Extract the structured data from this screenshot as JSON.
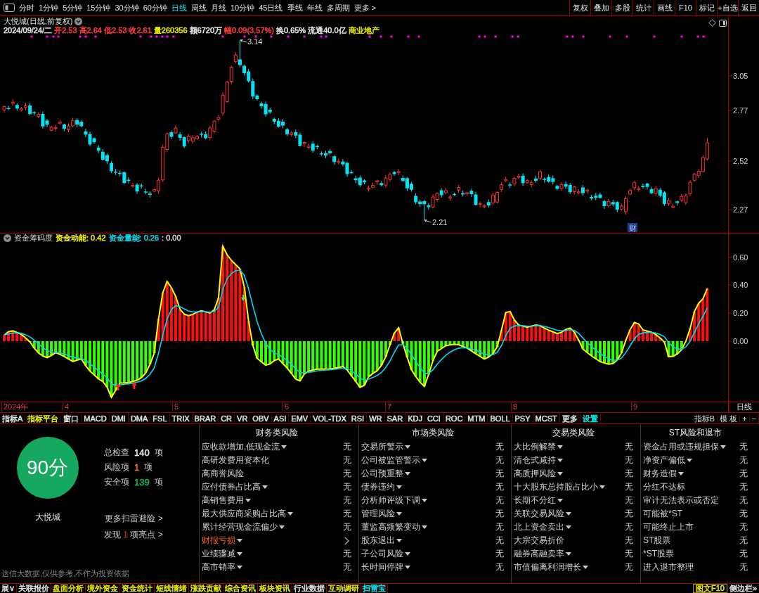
{
  "toolbar": {
    "tabs": [
      {
        "label": "分时",
        "selected": false
      },
      {
        "label": "1分钟",
        "selected": false
      },
      {
        "label": "5分钟",
        "selected": false
      },
      {
        "label": "15分钟",
        "selected": false
      },
      {
        "label": "30分钟",
        "selected": false
      },
      {
        "label": "60分钟",
        "selected": false
      },
      {
        "label": "日线",
        "selected": true
      },
      {
        "label": "周线",
        "selected": false
      },
      {
        "label": "月线",
        "selected": false
      },
      {
        "label": "10分钟",
        "selected": false
      },
      {
        "label": "45日线",
        "selected": false
      },
      {
        "label": "季线",
        "selected": false
      },
      {
        "label": "年线",
        "selected": false
      },
      {
        "label": "多周期",
        "selected": false
      },
      {
        "label": "更多 >",
        "selected": false
      }
    ],
    "buttons": [
      "复权",
      "叠加",
      "多股",
      "统计",
      "画线",
      "F10",
      "标记",
      "+自选",
      "返回"
    ]
  },
  "quote": {
    "title": "大悦城(日线,前复权)",
    "fields": [
      {
        "text": "2024/09/24/二",
        "color": "#e6e6e6"
      },
      {
        "text": "开2.53",
        "color": "#ff3c3c"
      },
      {
        "text": "高2.64",
        "color": "#ff3c3c"
      },
      {
        "text": "低2.53",
        "color": "#ff3c3c"
      },
      {
        "text": "收2.61",
        "color": "#ff3c3c"
      },
      {
        "text": "量260356",
        "color": "#e6e600"
      },
      {
        "text": "额6720万",
        "color": "#e6e6e6"
      },
      {
        "text": "幅0.09(3.57%)",
        "color": "#ff3c3c"
      },
      {
        "text": "换0.65%",
        "color": "#e6e6e6"
      },
      {
        "text": "流通40.0亿",
        "color": "#e6e6e6"
      },
      {
        "text": "商业地产",
        "color": "#e6e600"
      }
    ]
  },
  "price_chart": {
    "axis_labels": [
      "3.05",
      "2.77",
      "2.52",
      "2.27"
    ],
    "high_label": "3.14",
    "low_label": "2.21",
    "badge": "财"
  },
  "indicator": {
    "name": "资金筹码度",
    "readings": [
      {
        "text": "资金动能: 0.42",
        "color": "#f0f000"
      },
      {
        "text": "资金量能: 0.26",
        "color": "#00d8e8"
      },
      {
        "text": ": 0.00",
        "color": "#d0d0d0"
      }
    ],
    "axis_labels": [
      "0.60",
      "0.40",
      "0.20",
      "0.00"
    ]
  },
  "date_axis": {
    "labels": [
      "2024年",
      "4",
      "5",
      "6",
      "7",
      "8",
      "9"
    ],
    "period": "日线"
  },
  "indicator_tabs": {
    "items": [
      {
        "label": "指标A",
        "color": "#e0e0e0"
      },
      {
        "label": "指标平台",
        "color": "#f0f000"
      },
      {
        "label": "窗口",
        "color": "#e0e0e0"
      },
      {
        "label": "MACD",
        "color": "#e0e0e0"
      },
      {
        "label": "DMI",
        "color": "#e0e0e0"
      },
      {
        "label": "DMA",
        "color": "#e0e0e0"
      },
      {
        "label": "FSL",
        "color": "#e0e0e0"
      },
      {
        "label": "TRIX",
        "color": "#e0e0e0"
      },
      {
        "label": "BRAR",
        "color": "#e0e0e0"
      },
      {
        "label": "CR",
        "color": "#e0e0e0"
      },
      {
        "label": "VR",
        "color": "#e0e0e0"
      },
      {
        "label": "OBV",
        "color": "#e0e0e0"
      },
      {
        "label": "ASI",
        "color": "#e0e0e0"
      },
      {
        "label": "EMV",
        "color": "#e0e0e0"
      },
      {
        "label": "VOL-TDX",
        "color": "#e0e0e0"
      },
      {
        "label": "RSI",
        "color": "#e0e0e0"
      },
      {
        "label": "WR",
        "color": "#e0e0e0"
      },
      {
        "label": "SAR",
        "color": "#e0e0e0"
      },
      {
        "label": "KDJ",
        "color": "#e0e0e0"
      },
      {
        "label": "CCI",
        "color": "#e0e0e0"
      },
      {
        "label": "ROC",
        "color": "#e0e0e0"
      },
      {
        "label": "MTM",
        "color": "#e0e0e0"
      },
      {
        "label": "BOLL",
        "color": "#e0e0e0"
      },
      {
        "label": "PSY",
        "color": "#e0e0e0"
      },
      {
        "label": "MCST",
        "color": "#e0e0e0"
      },
      {
        "label": "更多",
        "color": "#e0e0e0"
      },
      {
        "label": "设置",
        "color": "#00e8e8"
      }
    ],
    "right": [
      "指标B",
      "模 板",
      "+",
      "−"
    ]
  },
  "risk_scan": {
    "score": "90分",
    "stock": "大悦城",
    "stats": [
      {
        "label": "总检查",
        "count": "140",
        "unit": "项",
        "color": "#e6e6e6"
      },
      {
        "label": "风险项",
        "count": "1",
        "unit": "项",
        "color": "#ff6a1a"
      },
      {
        "label": "安全项",
        "count": "139",
        "unit": "项",
        "color": "#19b35a"
      }
    ],
    "more_link": "更多扫雷避险 >",
    "highlight": {
      "prefix": "发现",
      "count": "1",
      "suffix": "项亮点 >"
    },
    "disclaimer": "达信大数据,仅供参考,不作为投资依据",
    "categories": [
      {
        "title": "财务类风险",
        "rows": [
          {
            "label": "应收款增加,低现金流",
            "menu": true,
            "flagged": false,
            "result": "无"
          },
          {
            "label": "高研发费用资本化",
            "menu": false,
            "flagged": false,
            "result": "无"
          },
          {
            "label": "高商誉风险",
            "menu": false,
            "flagged": false,
            "result": "无"
          },
          {
            "label": "应付债券占比高",
            "menu": true,
            "flagged": false,
            "result": "无"
          },
          {
            "label": "高销售费用",
            "menu": true,
            "flagged": false,
            "result": "无"
          },
          {
            "label": "最大供应商采购占比高",
            "menu": true,
            "flagged": false,
            "result": "无"
          },
          {
            "label": "累计经营现金流偏少",
            "menu": true,
            "flagged": false,
            "result": "无"
          },
          {
            "label": "财报亏损",
            "menu": true,
            "flagged": true
          },
          {
            "label": "业绩骤减",
            "menu": true,
            "flagged": false,
            "result": "无"
          },
          {
            "label": "高市销率",
            "menu": true,
            "flagged": false,
            "result": "无"
          }
        ]
      },
      {
        "title": "市场类风险",
        "rows": [
          {
            "label": "交易所警示",
            "menu": true,
            "flagged": false,
            "result": "无"
          },
          {
            "label": "公司被监管警示",
            "menu": true,
            "flagged": false,
            "result": "无"
          },
          {
            "label": "公司预重整",
            "menu": true,
            "flagged": false,
            "result": "无"
          },
          {
            "label": "债券违约",
            "menu": true,
            "flagged": false,
            "result": "无"
          },
          {
            "label": "分析师评级下调",
            "menu": true,
            "flagged": false,
            "result": "无"
          },
          {
            "label": "管理风险",
            "menu": true,
            "flagged": false,
            "result": "无"
          },
          {
            "label": "董监高频繁变动",
            "menu": true,
            "flagged": false,
            "result": "无"
          },
          {
            "label": "股东退出",
            "menu": true,
            "flagged": false,
            "result": "无"
          },
          {
            "label": "子公司风险",
            "menu": true,
            "flagged": false,
            "result": "无"
          },
          {
            "label": "长时间停牌",
            "menu": true,
            "flagged": false,
            "result": "无"
          }
        ]
      },
      {
        "title": "交易类风险",
        "rows": [
          {
            "label": "大比例解禁",
            "menu": true,
            "flagged": false,
            "result": "无"
          },
          {
            "label": "清仓式减持",
            "menu": true,
            "flagged": false,
            "result": "无"
          },
          {
            "label": "高质押风险",
            "menu": true,
            "flagged": false,
            "result": "无"
          },
          {
            "label": "十大股东总持股占比小",
            "menu": true,
            "flagged": false,
            "result": "无"
          },
          {
            "label": "长期不分红",
            "menu": true,
            "flagged": false,
            "result": "无"
          },
          {
            "label": "关联交易风险",
            "menu": true,
            "flagged": false,
            "result": "无"
          },
          {
            "label": "北上资金卖出",
            "menu": true,
            "flagged": false,
            "result": "无"
          },
          {
            "label": "大宗交易折价",
            "menu": false,
            "flagged": false,
            "result": "无"
          },
          {
            "label": "融券高融卖率",
            "menu": true,
            "flagged": false,
            "result": "无"
          },
          {
            "label": "市值偏离利润增长",
            "menu": true,
            "flagged": false,
            "result": "无"
          }
        ]
      },
      {
        "title": "ST风险和退市",
        "rows": [
          {
            "label": "资金占用或违规担保",
            "menu": true,
            "flagged": false,
            "result": "无"
          },
          {
            "label": "净资产偏低",
            "menu": true,
            "flagged": false,
            "result": "无"
          },
          {
            "label": "财务造假",
            "menu": true,
            "flagged": false,
            "result": "无"
          },
          {
            "label": "分红不达标",
            "menu": false,
            "flagged": false,
            "result": "无"
          },
          {
            "label": "审计无法表示或否定",
            "menu": false,
            "flagged": false,
            "result": "无"
          },
          {
            "label": "可能被*ST",
            "menu": false,
            "flagged": false,
            "result": "无"
          },
          {
            "label": "可能终止上市",
            "menu": false,
            "flagged": false,
            "result": "无"
          },
          {
            "label": "ST股票",
            "menu": false,
            "flagged": false,
            "result": "无"
          },
          {
            "label": "*ST股票",
            "menu": false,
            "flagged": false,
            "result": "无"
          },
          {
            "label": "进入退市整理",
            "menu": false,
            "flagged": false,
            "result": "无"
          }
        ]
      }
    ]
  },
  "bottom_tabs": {
    "items": [
      {
        "label": "展∨",
        "color": "#e0e0e0",
        "selected": false
      },
      {
        "label": "关联报价",
        "color": "#e0e0e0",
        "selected": false
      },
      {
        "label": "盘面分析",
        "color": "#e8e800",
        "selected": false
      },
      {
        "label": "境外资金",
        "color": "#e8e800",
        "selected": false
      },
      {
        "label": "资金统计",
        "color": "#e8e800",
        "selected": false
      },
      {
        "label": "短线情绪",
        "color": "#e8e800",
        "selected": false
      },
      {
        "label": "涨跌贡献",
        "color": "#e8e800",
        "selected": false
      },
      {
        "label": "综合资讯",
        "color": "#e8e800",
        "selected": false
      },
      {
        "label": "板块资讯",
        "color": "#e8e800",
        "selected": false
      },
      {
        "label": "行业数据",
        "color": "#e0e0e0",
        "selected": false
      },
      {
        "label": "互动调研",
        "color": "#e8e800",
        "selected": false
      },
      {
        "label": "扫雷宝",
        "color": "#00e5f0",
        "selected": true
      }
    ],
    "right": [
      {
        "label": "图文F10",
        "color": "#e8e800",
        "kind": "boxed"
      },
      {
        "label": "侧边栏»",
        "color": "#e0e0e0",
        "kind": "plain"
      }
    ]
  }
}
